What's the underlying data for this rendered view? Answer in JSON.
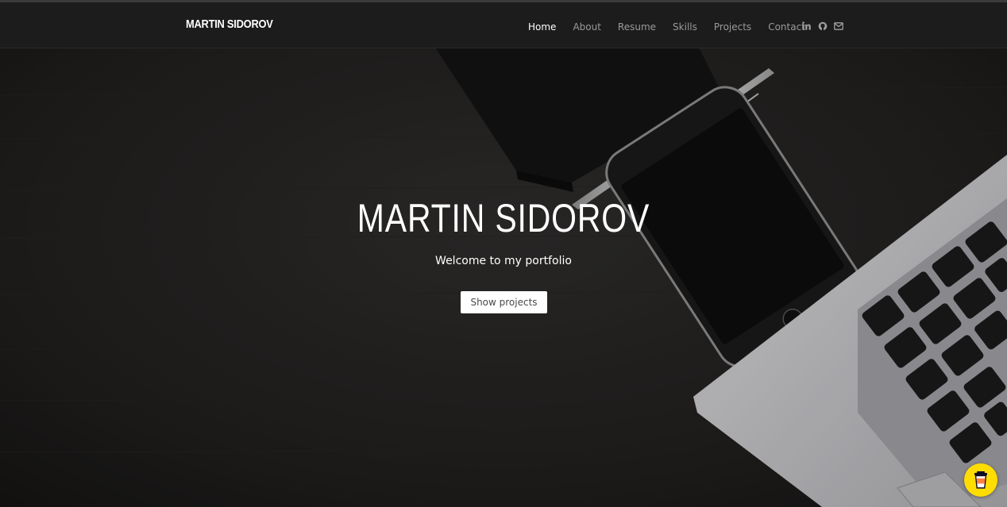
{
  "navbar": {
    "brand": "MARTIN SIDOROV",
    "links": [
      {
        "label": "Home",
        "active": true
      },
      {
        "label": "About",
        "active": false
      },
      {
        "label": "Resume",
        "active": false
      },
      {
        "label": "Skills",
        "active": false
      },
      {
        "label": "Projects",
        "active": false
      },
      {
        "label": "Contact",
        "active": false
      }
    ],
    "icons": [
      "linkedin-icon",
      "github-icon",
      "envelope-icon"
    ]
  },
  "hero": {
    "title": "MARTIN SIDOROV",
    "subtitle": "Welcome to my portfolio",
    "button_label": "Show projects"
  },
  "floating": {
    "icon": "coffee-cup-icon",
    "color": "#ffdd00"
  },
  "colors": {
    "navbar_bg": "#1c1c1c",
    "nav_active": "#ffffff",
    "nav_inactive": "#9a9a9a"
  }
}
